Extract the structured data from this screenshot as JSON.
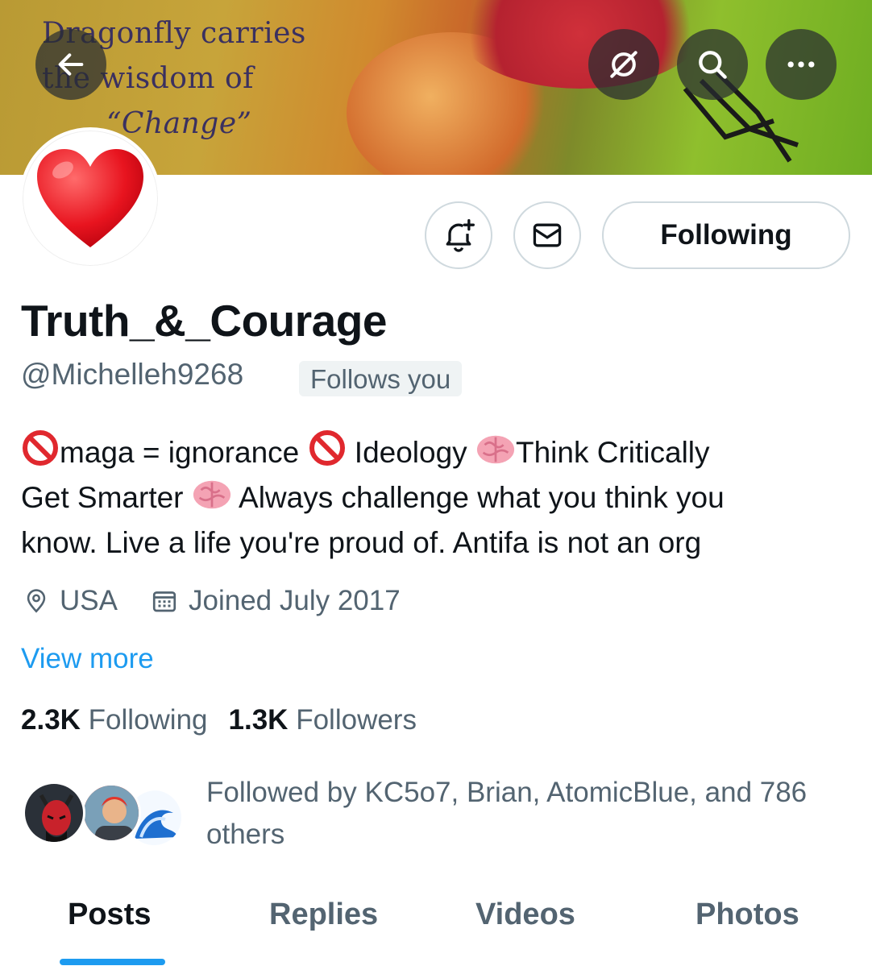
{
  "banner": {
    "text_line1": "Dragonfly carries",
    "text_line2": "the wisdom of",
    "text_line3": "“Change”"
  },
  "header_actions": {
    "back_icon": "arrow-left-icon",
    "grok_icon": "slashed-circle-icon",
    "search_icon": "search-icon",
    "more_icon": "more-horizontal-icon"
  },
  "profile": {
    "avatar_emoji": "❤️",
    "display_name": "Truth_&_Courage",
    "handle": "@Michelleh9268",
    "follows_you_badge": "Follows you",
    "follow_button_label": "Following",
    "bio": {
      "line1_a": "maga = ignorance",
      "line1_b": "Ideology",
      "line1_c": "Think Critically",
      "line2_a": "Get Smarter",
      "line2_b": "Always challenge what you think you",
      "line3": "know. Live a life you're proud of. Antifa is not an org"
    },
    "location": "USA",
    "joined": "Joined July 2017",
    "view_more": "View more",
    "following_count": "2.3K",
    "following_label": "Following",
    "followers_count": "1.3K",
    "followers_label": "Followers",
    "followed_by": "Followed by KC5o7, Brian, AtomicBlue, and 786 others"
  },
  "tabs": [
    "Posts",
    "Replies",
    "Videos",
    "Photos"
  ],
  "active_tab": "Posts",
  "colors": {
    "accent": "#1d9bf0",
    "text_primary": "#0f1419",
    "text_secondary": "#536471",
    "border": "#cfd9de"
  }
}
